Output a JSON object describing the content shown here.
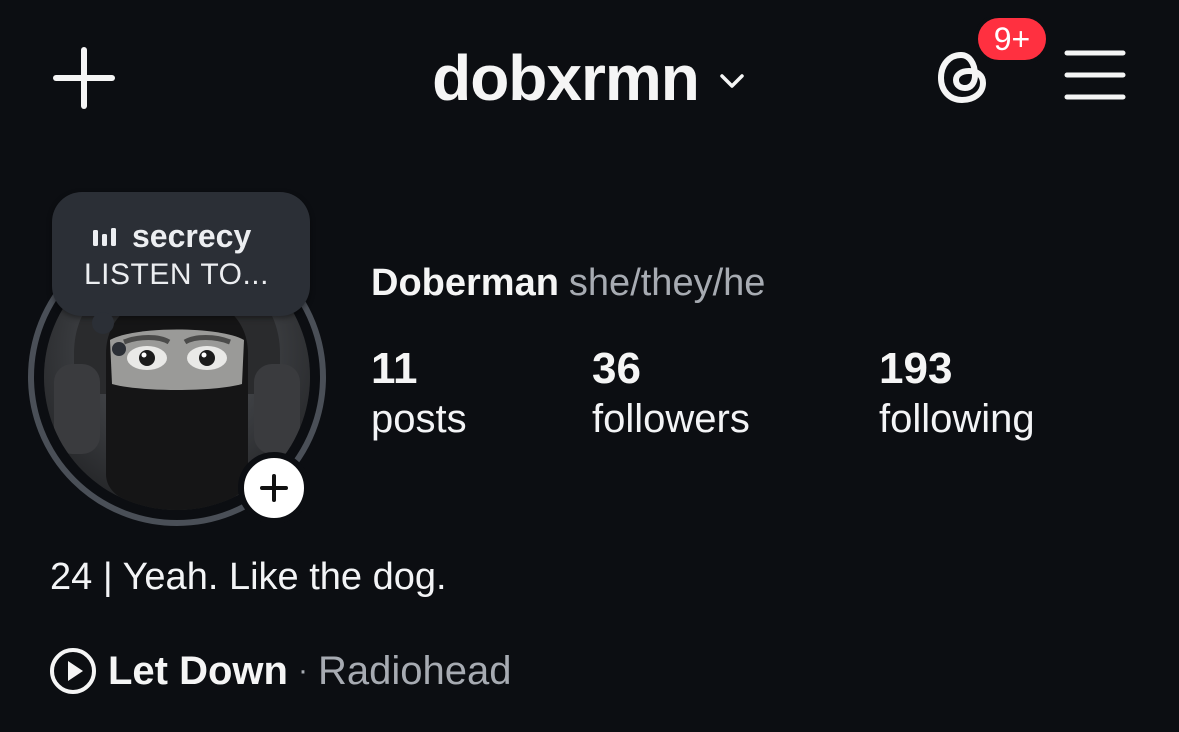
{
  "header": {
    "username": "dobxrmn",
    "notifications_badge": "9+",
    "icons": {
      "create": "plus-icon",
      "switch_account": "chevron-down-icon",
      "threads": "threads-icon",
      "menu": "hamburger-menu-icon"
    }
  },
  "profile": {
    "note": {
      "title": "secrecy",
      "subtitle": "LISTEN TO..."
    },
    "display_name": "Doberman",
    "pronouns": "she/they/he",
    "stats": [
      {
        "value": "11",
        "label": "posts"
      },
      {
        "value": "36",
        "label": "followers"
      },
      {
        "value": "193",
        "label": "following"
      }
    ],
    "bio": "24 | Yeah. Like the dog.",
    "music": {
      "song": "Let Down",
      "separator": "·",
      "artist": "Radiohead"
    }
  },
  "colors": {
    "background": "#0c0e12",
    "badge": "#ff3040",
    "secondary_text": "#a7abb2",
    "ring": "#4a4f57",
    "note_bubble": "#2b2f36"
  }
}
